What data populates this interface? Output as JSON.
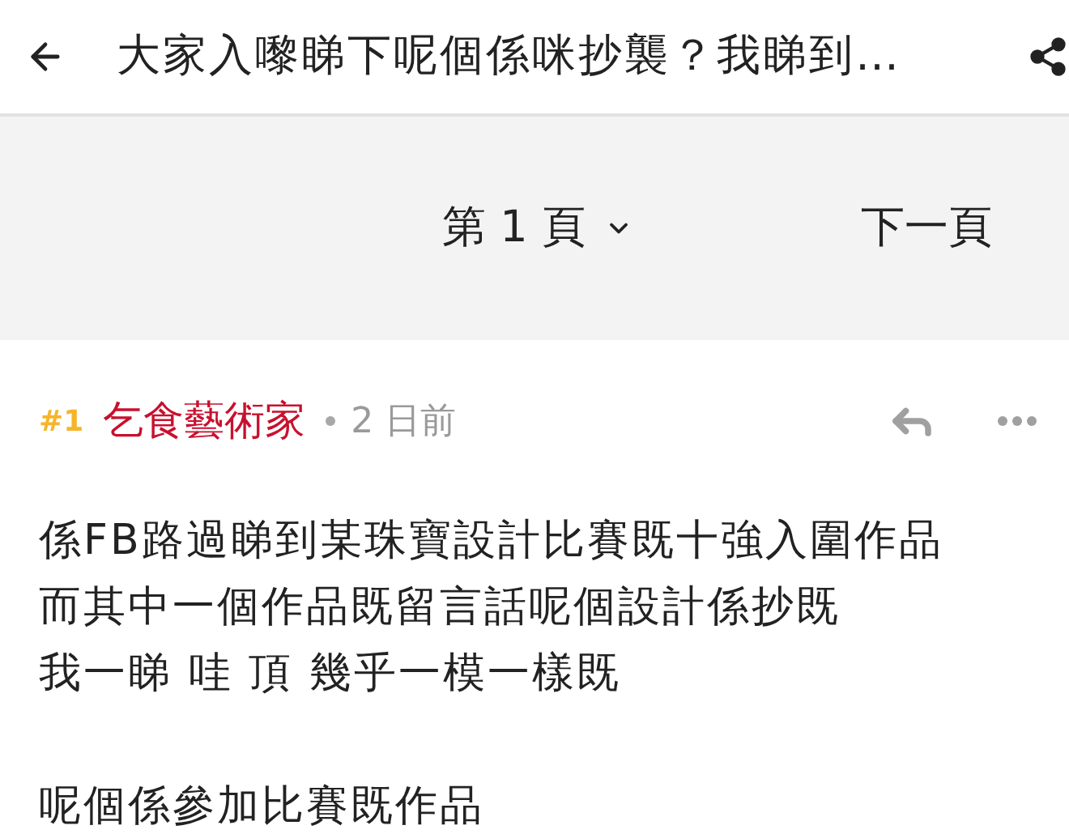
{
  "top_bar": {
    "title": "大家入嚟睇下呢個係咪抄襲？我睇到…"
  },
  "pager": {
    "page_label": "第 1 頁",
    "next_label": "下一頁"
  },
  "post": {
    "number": "#1",
    "author": "乞食藝術家",
    "time": "2 日前",
    "paragraphs": [
      [
        "係FB路過睇到某珠寶設計比賽既十強入圍作品",
        "而其中一個作品既留言話呢個設計係抄既",
        "我一睇 哇 頂 幾乎一模一樣既"
      ],
      [
        "呢個係參加比賽既作品"
      ]
    ]
  }
}
